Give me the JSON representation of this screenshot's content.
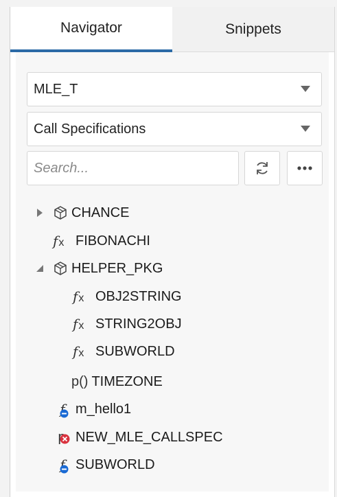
{
  "tabs": [
    {
      "label": "Navigator",
      "active": true
    },
    {
      "label": "Snippets",
      "active": false
    }
  ],
  "schema_select": {
    "value": "MLE_T"
  },
  "type_select": {
    "value": "Call Specifications"
  },
  "search": {
    "placeholder": "Search..."
  },
  "toolbar": {
    "refresh_icon": "refresh-icon",
    "more_icon": "more-icon"
  },
  "colors": {
    "accent": "#2b6aa6",
    "status_blue": "#1a6ad4",
    "status_red": "#d9323e"
  },
  "tree": {
    "chance": {
      "label": "CHANCE",
      "type": "package",
      "expanded": false
    },
    "fibonachi": {
      "label": "FIBONACHI",
      "type": "function"
    },
    "helper_pkg": {
      "label": "HELPER_PKG",
      "type": "package",
      "expanded": true
    },
    "obj2string": {
      "label": "OBJ2STRING",
      "type": "function"
    },
    "string2obj": {
      "label": "STRING2OBJ",
      "type": "function"
    },
    "subworld_inner": {
      "label": "SUBWORLD",
      "type": "function"
    },
    "timezone": {
      "label": "TIMEZONE",
      "type": "procedure",
      "glyph": "p()"
    },
    "m_hello1": {
      "label": "m_hello1",
      "type": "function-status-blue"
    },
    "new_mle_callspec": {
      "label": "NEW_MLE_CALLSPEC",
      "type": "procedure-status-error",
      "glyph": "p"
    },
    "subworld": {
      "label": "SUBWORLD",
      "type": "function-status-blue"
    }
  }
}
